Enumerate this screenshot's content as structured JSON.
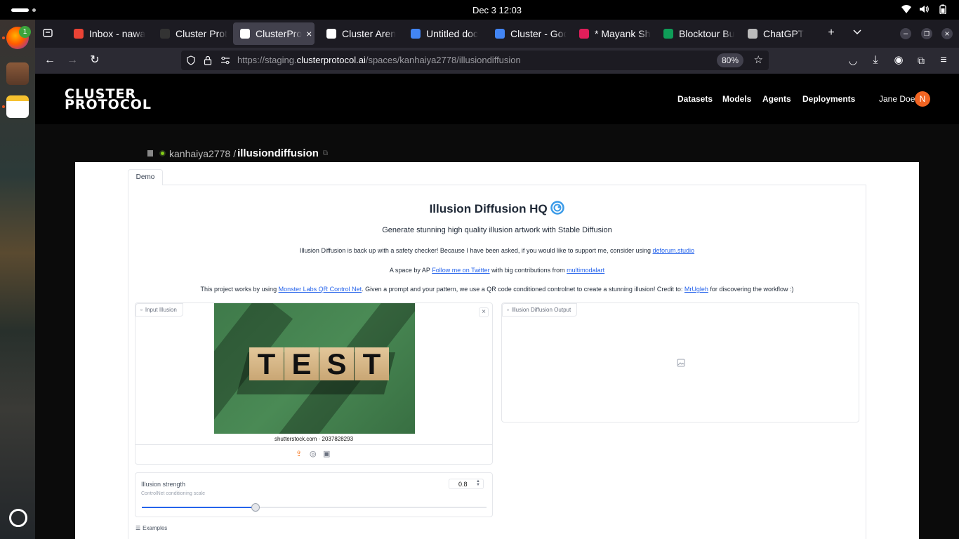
{
  "os": {
    "date_time": "Dec 3  12:03",
    "badge_count": "1"
  },
  "browser": {
    "tabs": [
      {
        "label": "Inbox - nawa",
        "fav": "#ea4335"
      },
      {
        "label": "Cluster Proto",
        "fav": "#333"
      },
      {
        "label": "ClusterPro",
        "fav": "#fff"
      },
      {
        "label": "Cluster Aren",
        "fav": "#fff"
      },
      {
        "label": "Untitled doc",
        "fav": "#4285f4"
      },
      {
        "label": "Cluster - Goo",
        "fav": "#4285f4"
      },
      {
        "label": "* Mayank Sha",
        "fav": "#e01e5a"
      },
      {
        "label": "Blocktour Bu",
        "fav": "#0f9d58"
      },
      {
        "label": "ChatGPT",
        "fav": "#bbb"
      }
    ],
    "close_tab": "×",
    "new_tab": "+",
    "url_prefix": "https://staging.",
    "url_domain": "clusterprotocol.ai",
    "url_path": "/spaces/kanhaiya2778/illusiondiffusion",
    "zoom": "80%"
  },
  "site": {
    "logo_line1": "CLUSTER",
    "logo_line2": "PROTOCOL",
    "nav": [
      "Datasets",
      "Models",
      "Agents",
      "Deployments"
    ],
    "user_name": "Jane Doe",
    "avatar_initial": "N",
    "owner": "kanhaiya2778",
    "separator": "/",
    "space_name": "illusiondiffusion"
  },
  "app": {
    "tab_demo": "Demo",
    "title": "Illusion Diffusion HQ",
    "subtitle": "Generate stunning high quality illusion artwork with Stable Diffusion",
    "line1_text": "Illusion Diffusion is back up with a safety checker! Because I have been asked, if you would like to support me, consider using ",
    "line1_link": "deforum.studio",
    "line2_a": "A space by AP ",
    "line2_link1": "Follow me on Twitter",
    "line2_b": " with big contributions from ",
    "line2_link2": "multimodalart",
    "line3_a": "This project works by using ",
    "line3_link1": "Monster Labs QR Control Net",
    "line3_b": ". Given a prompt and your pattern, we use a QR code conditioned controlnet to create a stunning illusion! Credit to: ",
    "line3_link2": "MrUgleh",
    "line3_c": " for discovering the workflow :)",
    "input_label": "Input Illusion",
    "output_label": "Illusion Diffusion Output",
    "image_word": [
      "T",
      "E",
      "S",
      "T"
    ],
    "image_caption": "shutterstock.com · 2037828293",
    "strength_label": "Illusion strength",
    "strength_info": "ControlNet conditioning scale",
    "strength_value": "0.8",
    "strength_fraction": 0.33,
    "examples_label": "Examples"
  }
}
